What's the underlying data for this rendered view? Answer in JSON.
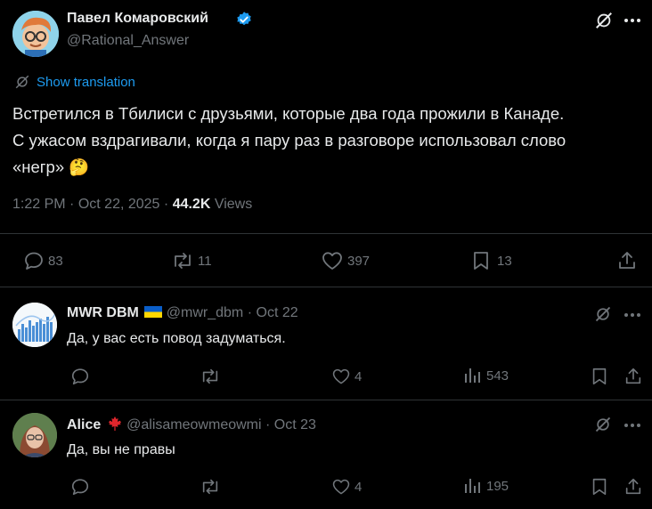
{
  "main_post": {
    "author_name": "Павел Комаровский",
    "handle": "@Rational_Answer",
    "show_translation": "Show translation",
    "text_line1": "Встретился в Тбилиси с друзьями, которые два года прожили в Канаде.",
    "text_line2": "С ужасом вздрагивали, когда я пару раз в разговоре использовал слово",
    "text_line3": "«негр»",
    "emoji": "🤔",
    "time": "1:22 PM",
    "date": "Oct 22, 2025",
    "views_count": "44.2K",
    "views_label": "Views",
    "replies": "83",
    "reposts": "11",
    "likes": "397",
    "bookmarks": "13"
  },
  "replies": [
    {
      "author_name": "MWR DBM",
      "handle": "@mwr_dbm",
      "date": "Oct 22",
      "text": "Да, у вас есть повод задуматься.",
      "likes": "4",
      "views": "543"
    },
    {
      "author_name": "Alice",
      "handle": "@alisameowmeowmi",
      "date": "Oct 23",
      "text": "Да, вы не правы",
      "likes": "4",
      "views": "195"
    }
  ],
  "dot": "·",
  "colors": {
    "accent": "#1d9bf0",
    "muted": "#71767b",
    "divider": "#2f3336",
    "text": "#e7e9ea"
  },
  "icons": [
    "verified-badge-icon",
    "grok-icon",
    "more-icon",
    "translate-icon",
    "reply-icon",
    "repost-icon",
    "like-icon",
    "bookmark-icon",
    "share-icon",
    "views-icon",
    "ukraine-flag-icon",
    "maple-leaf-icon"
  ]
}
